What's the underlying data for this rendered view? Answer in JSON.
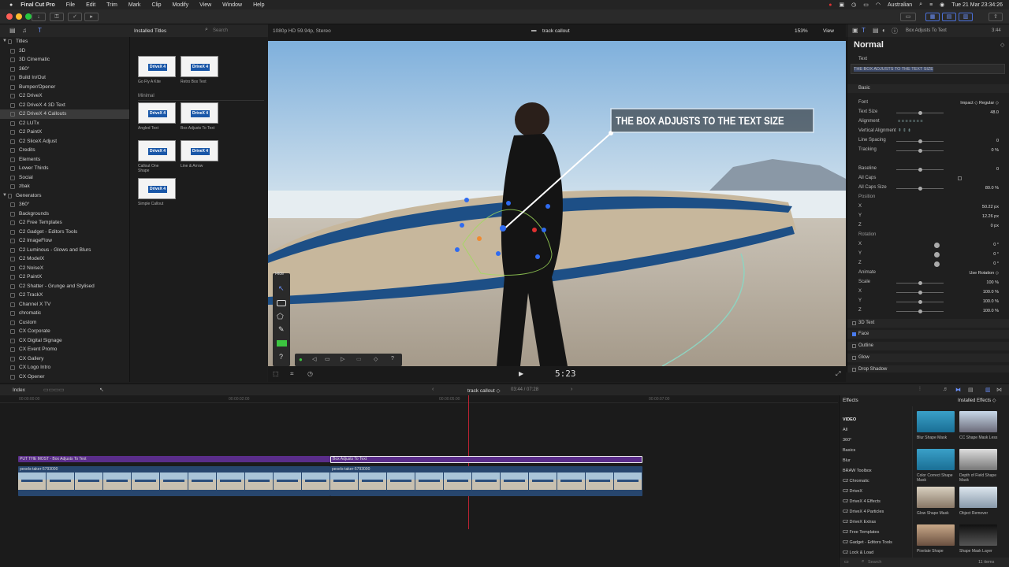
{
  "menubar": {
    "app": "Final Cut Pro",
    "items": [
      "File",
      "Edit",
      "Trim",
      "Mark",
      "Clip",
      "Modify",
      "View",
      "Window",
      "Help"
    ],
    "input_source": "Australian",
    "datetime": "Tue 21 Mar  23:34:26"
  },
  "library": {
    "browser_title": "Installed Titles",
    "search_placeholder": "Search"
  },
  "sidebar": {
    "titles_label": "Titles",
    "title_items": [
      "3D",
      "3D Cinematic",
      "360°",
      "Build In/Out",
      "Bumper/Opener",
      "C2 DriveX",
      "C2 DriveX 4 3D Text",
      "C2 DriveX 4 Callouts",
      "C2 LUTx",
      "C2 PaintX",
      "C2 SliceX Adjust",
      "Credits",
      "Elements",
      "Lower Thirds",
      "Social",
      "zbak"
    ],
    "generators_label": "Generators",
    "generator_items": [
      "360°",
      "Backgrounds",
      "C2 Free Templates",
      "C2 Gadget - Editors Tools",
      "C2 ImageFlow",
      "C2 Luminous - Glows and Blurs",
      "C2 ModelX",
      "C2 NoiseX",
      "C2 PaintX",
      "C2 Shatter - Grunge and Stylised",
      "C2 TrackX",
      "Channel X TV",
      "chromatic",
      "Custom",
      "CX Corporate",
      "CX Digital Signage",
      "CX Event Promo",
      "CX Gallery",
      "CX Logo Intro",
      "CX Opener"
    ]
  },
  "browser": {
    "thumb_label": "DriveX 4",
    "row1": [
      "Go Fly A Kite",
      "Retro Box Text"
    ],
    "section": "Minimal",
    "row2": [
      "Angled Text",
      "Box Adjusts To Text"
    ],
    "row3": [
      "Callout One Shape",
      "Line & Arrow"
    ],
    "row4": [
      "Simple Callout"
    ]
  },
  "viewer": {
    "format": "1080p HD 59.94p, Stereo",
    "project": "track callout",
    "zoom": "153%",
    "view_menu": "View",
    "callout_text": "THE BOX ADJUSTS TO THE TEXT SIZE",
    "hide_label": "Hide",
    "timecode": "5:23"
  },
  "inspector": {
    "header": "Box Adjusts To Text",
    "duration": "3:44",
    "style": "Normal",
    "text_label": "Text",
    "text_value": "THE BOX ADJUSTS TO THE TEXT SIZE",
    "basic_label": "Basic",
    "rows": [
      {
        "label": "Font",
        "value": "Impact  ◇    Regular  ◇"
      },
      {
        "label": "Text Size",
        "value": "48.0"
      },
      {
        "label": "Alignment",
        "value": ""
      },
      {
        "label": "Vertical Alignment",
        "value": ""
      },
      {
        "label": "Line Spacing",
        "value": "0"
      },
      {
        "label": "Tracking",
        "value": "0   %"
      },
      {
        "label": "Baseline",
        "value": "0"
      },
      {
        "label": "All Caps",
        "value": ""
      },
      {
        "label": "All Caps Size",
        "value": "80.0  %"
      },
      {
        "label": "Position",
        "value": ""
      },
      {
        "label": "X",
        "value": "50.22  px"
      },
      {
        "label": "Y",
        "value": "12.26  px"
      },
      {
        "label": "Z",
        "value": "0   px"
      },
      {
        "label": "Rotation",
        "value": ""
      },
      {
        "label": "X",
        "value": "0   °"
      },
      {
        "label": "Y",
        "value": "0   °"
      },
      {
        "label": "Z",
        "value": "0   °"
      },
      {
        "label": "Animate",
        "value": "Use Rotation ◇"
      },
      {
        "label": "Scale",
        "value": "100  %"
      },
      {
        "label": "X",
        "value": "100.0  %"
      },
      {
        "label": "Y",
        "value": "100.0  %"
      },
      {
        "label": "Z",
        "value": "100.0  %"
      }
    ],
    "sections": [
      "3D Text",
      "Face",
      "Outline",
      "Glow",
      "Drop Shadow"
    ]
  },
  "timeline": {
    "index_label": "Index",
    "project": "track callout ◇",
    "position": "03:44 / 07:28",
    "ruler": [
      "00:00:00:00",
      "00:00:02:00",
      "00:00:05:00",
      "00:00:07:00"
    ],
    "title_clip_1": "PUT THE MOST - Box Adjusts To Text",
    "title_clip_2": "Box Adjusts To Text",
    "video_clip_1": "pexels-taker-5793000",
    "video_clip_2": "pexels-taker-5793000"
  },
  "effects": {
    "header": "Effects",
    "installed": "Installed Effects ◇",
    "categories": [
      "VIDEO",
      "All",
      "360°",
      "Basics",
      "Blur",
      "BRAW Toolbox",
      "C2 Chromatic",
      "C2 DriveX",
      "C2 DriveX 4 Effects",
      "C2 DriveX 4 Particles",
      "C2 DriveX Extras",
      "C2 Free Templates",
      "C2 Gadget - Editors Tools",
      "C2 Lock & Load"
    ],
    "items": [
      "Blur Shape Mask",
      "CC Shape Mask Less",
      "Color Correct Shape Mask",
      "Depth of Field Shape Mask",
      "Glow Shape Mask",
      "Object Remover",
      "Pixelate Shape",
      "Shape Mask Layer"
    ],
    "search_placeholder": "Search",
    "count": "11 items"
  }
}
